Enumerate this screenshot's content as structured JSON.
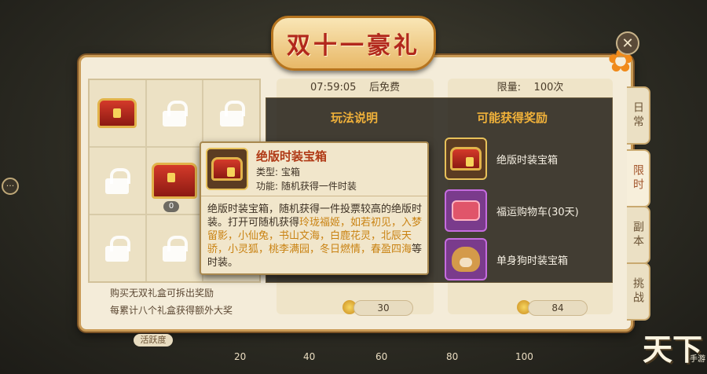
{
  "title": "双十一豪礼",
  "close_label": "✕",
  "timer": {
    "time": "07:59:05",
    "label": "后免费"
  },
  "limit": {
    "label": "限量:",
    "value": "100次"
  },
  "left": {
    "badge": "0",
    "line1": "购买无双礼盒可拆出奖励",
    "line2": "每累计八个礼盒获得额外大奖"
  },
  "overlay": {
    "rules_title": "玩法说明",
    "rewards_title": "可能获得奖励",
    "rewards": [
      {
        "name": "绝版时装宝箱",
        "icon": "chest-icon"
      },
      {
        "name": "福运购物车(30天)",
        "icon": "cart-icon"
      },
      {
        "name": "单身狗时装宝箱",
        "icon": "dog-icon"
      }
    ]
  },
  "tooltip": {
    "name": "绝版时装宝箱",
    "type": "类型: 宝箱",
    "function": "功能: 随机获得一件时装",
    "desc_plain1": "绝版时装宝箱，随机获得一件投票较高的绝版时装。打开可随机获得",
    "desc_highlight": "玲珑福姬，如若初见，入梦留影，小仙兔，书山文海，白鹿花灵，北辰天骄，小灵狐，桃李满园，冬日燃情，春盈四海",
    "desc_plain2": "等时装。"
  },
  "costs": {
    "left": "30",
    "right": "84"
  },
  "tabs": [
    "日常",
    "限时",
    "副本",
    "挑战"
  ],
  "bottom": {
    "label": "活跃度",
    "marks": [
      "20",
      "40",
      "60",
      "80",
      "100"
    ]
  },
  "logo": {
    "main": "天下",
    "sub": "手游"
  }
}
